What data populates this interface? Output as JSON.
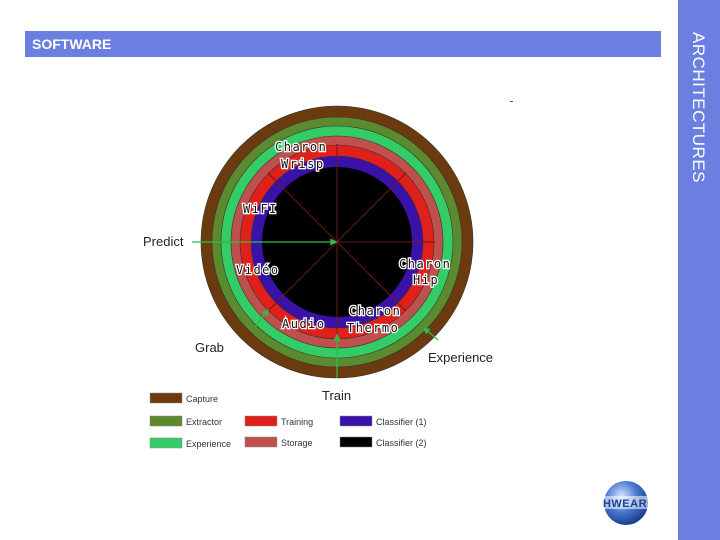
{
  "header": {
    "title": "SOFTWARE"
  },
  "sidebar": {
    "title": "ARCHITECTURES"
  },
  "diagram": {
    "stages": {
      "predict": "Predict",
      "grab": "Grab",
      "train": "Train",
      "experience": "Experience"
    },
    "modules": {
      "wrisp": "Charon Wrisp",
      "wifi": "WiFI",
      "video": "Vidéo",
      "hip": "Charon Hip",
      "audio": "Audio",
      "thermo": "Charon Thermo"
    },
    "rings": {
      "capture": "#6b3a0e",
      "extractor": "#5c8a2e",
      "experience": "#33cc66",
      "storage": "#c0504d",
      "training": "#e0201a",
      "classifier1": "#3a12a8",
      "classifier2": "#000000"
    },
    "legend": [
      {
        "label": "Capture",
        "color": "#6b3a0e"
      },
      {
        "label": "Extractor",
        "color": "#5c8a2e"
      },
      {
        "label": "Experience",
        "color": "#33cc66"
      },
      {
        "label": "Training",
        "color": "#e0201a"
      },
      {
        "label": "Storage",
        "color": "#c0504d"
      },
      {
        "label": "Classifier (1)",
        "color": "#3a12a8"
      },
      {
        "label": "Classifier (2)",
        "color": "#000000"
      }
    ]
  },
  "logo": {
    "text": "HWEAR"
  }
}
